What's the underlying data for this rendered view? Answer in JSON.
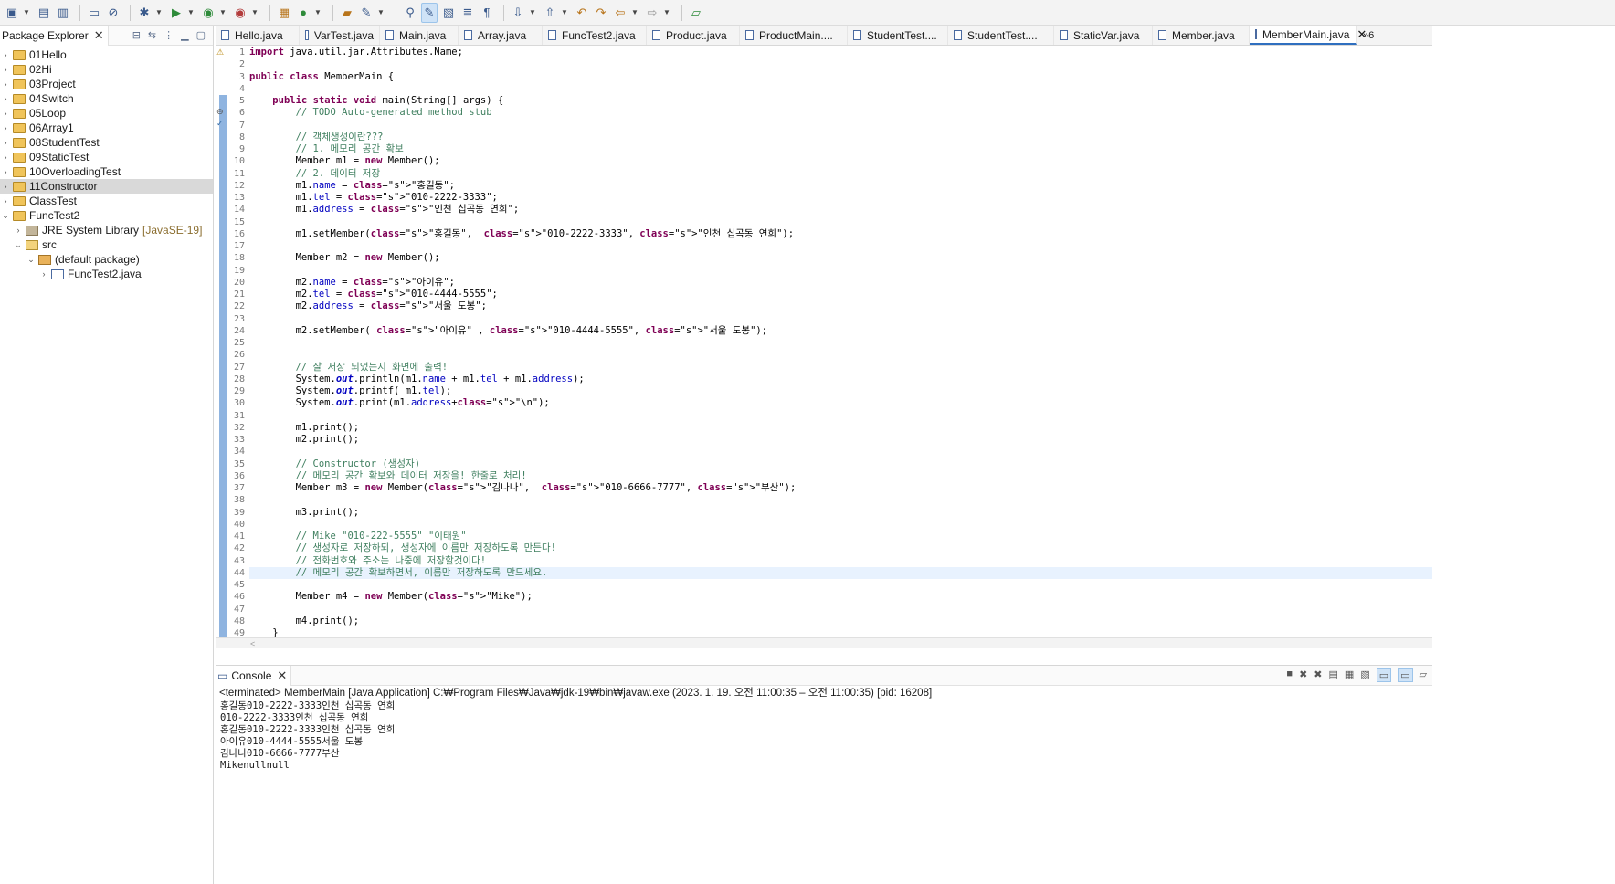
{
  "explorer": {
    "title": "Package Explorer",
    "items": [
      {
        "label": "01Hello",
        "type": "project"
      },
      {
        "label": "02Hi",
        "type": "project"
      },
      {
        "label": "03Project",
        "type": "project"
      },
      {
        "label": "04Switch",
        "type": "project"
      },
      {
        "label": "05Loop",
        "type": "project"
      },
      {
        "label": "06Array1",
        "type": "project"
      },
      {
        "label": "08StudentTest",
        "type": "project"
      },
      {
        "label": "09StaticTest",
        "type": "project"
      },
      {
        "label": "10OverloadingTest",
        "type": "project"
      },
      {
        "label": "11Constructor",
        "type": "project",
        "selected": true
      },
      {
        "label": "ClassTest",
        "type": "project"
      },
      {
        "label": "FuncTest2",
        "type": "project",
        "expanded": true
      },
      {
        "label": "JRE System Library",
        "suffix": "[JavaSE-19]",
        "type": "library"
      },
      {
        "label": "src",
        "type": "source"
      },
      {
        "label": "(default package)",
        "type": "package"
      },
      {
        "label": "FuncTest2.java",
        "type": "java"
      }
    ]
  },
  "editor": {
    "tabs": [
      {
        "label": "Hello.java"
      },
      {
        "label": "VarTest.java"
      },
      {
        "label": "Main.java"
      },
      {
        "label": "Array.java"
      },
      {
        "label": "FuncTest2.java"
      },
      {
        "label": "Product.java"
      },
      {
        "label": "ProductMain...."
      },
      {
        "label": "StudentTest...."
      },
      {
        "label": "StudentTest...."
      },
      {
        "label": "StaticVar.java"
      },
      {
        "label": "Member.java"
      },
      {
        "label": "MemberMain.java",
        "active": true
      }
    ],
    "overflow_tab": "»6",
    "code": [
      "import java.util.jar.Attributes.Name;",
      "",
      "public class MemberMain {",
      "",
      "    public static void main(String[] args) {",
      "        // TODO Auto-generated method stub",
      "",
      "        // 객체생성이란???",
      "        // 1. 메모리 공간 확보",
      "        Member m1 = new Member();",
      "        // 2. 데이터 저장",
      "        m1.name = \"홍길동\";",
      "        m1.tel = \"010-2222-3333\";",
      "        m1.address = \"인천 십곡동 연희\";",
      "",
      "        m1.setMember(\"홍길동\",  \"010-2222-3333\", \"인천 십곡동 연희\");",
      "",
      "        Member m2 = new Member();",
      "",
      "        m2.name = \"아이유\";",
      "        m2.tel = \"010-4444-5555\";",
      "        m2.address = \"서울 도봉\";",
      "",
      "        m2.setMember( \"아이유\" , \"010-4444-5555\", \"서울 도봉\");",
      "",
      "",
      "        // 잘 저장 되었는지 화면에 출력!",
      "        System.out.println(m1.name + m1.tel + m1.address);",
      "        System.out.printf( m1.tel);",
      "        System.out.print(m1.address+\"\\n\");",
      "",
      "        m1.print();",
      "        m2.print();",
      "",
      "        // Constructor (생성자)",
      "        // 메모리 공간 확보와 데이터 저장을! 한줄로 처리!",
      "        Member m3 = new Member(\"김나나\",  \"010-6666-7777\", \"부산\");",
      "",
      "        m3.print();",
      "",
      "        // Mike \"010-222-5555\" \"이태원\"",
      "        // 생성자로 저장하되, 생성자에 이름만 저장하도록 만든다!",
      "        // 전화번호와 주소는 나중에 저장할것이다!",
      "        // 메모리 공간 확보하면서, 이름만 저장하도록 만드세요.",
      "",
      "        Member m4 = new Member(\"Mike\");",
      "",
      "        m4.print();",
      "    }",
      ""
    ]
  },
  "console": {
    "title": "Console",
    "status": "<terminated> MemberMain [Java Application] C:₩Program Files₩Java₩jdk-19₩bin₩javaw.exe  (2023. 1. 19. 오전 11:00:35 – 오전 11:00:35) [pid: 16208]",
    "lines": [
      "홍길동010-2222-3333인천 십곡동 연희",
      "010-2222-3333인천 십곡동 연희",
      "홍길동010-2222-3333인천 십곡동 연희",
      "아이유010-4444-5555서울 도봉",
      "김나나010-6666-7777부산",
      "Mikenullnull"
    ]
  }
}
